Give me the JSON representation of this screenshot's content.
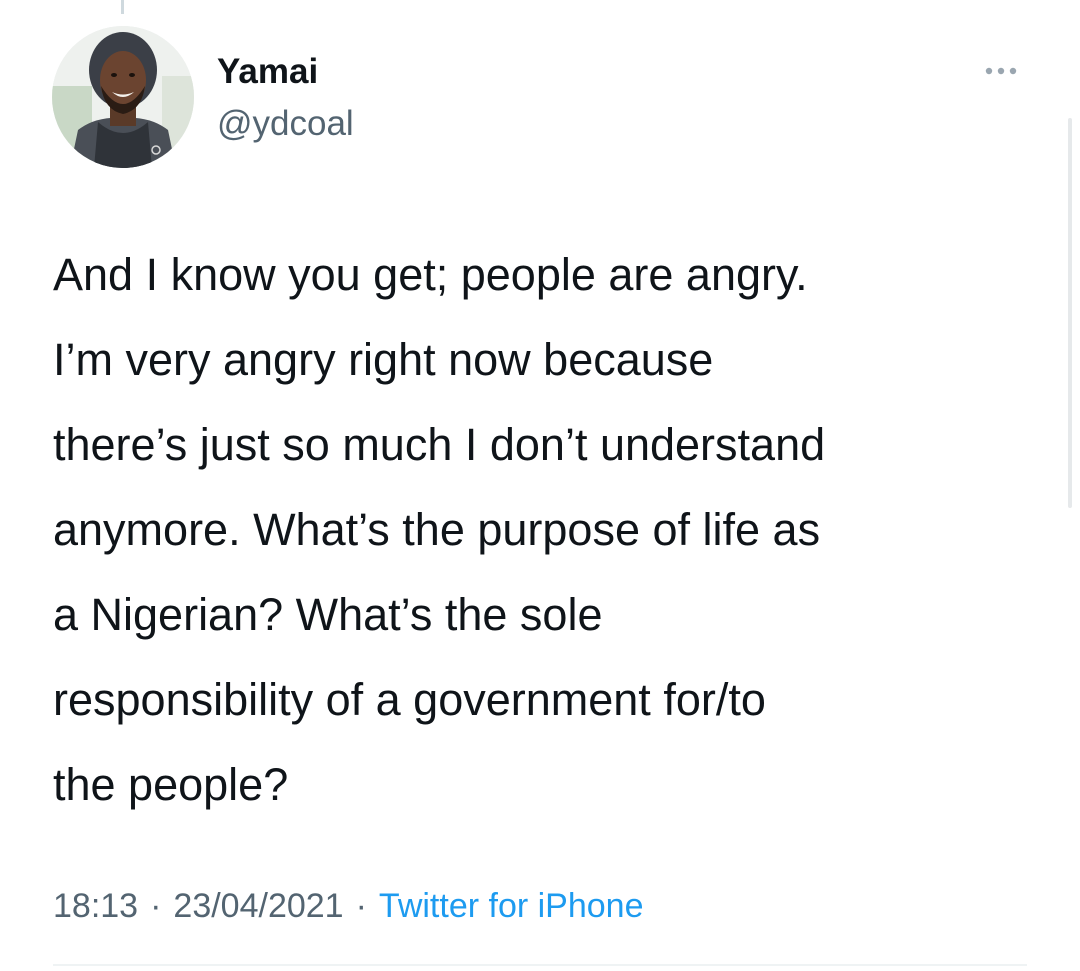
{
  "tweet": {
    "author": {
      "display_name": "Yamai",
      "handle": "@ydcoal",
      "avatar_icon": "user-avatar-photo"
    },
    "more_icon": "more-horizontal-icon",
    "text_lines": [
      "And I know you get; people are angry.",
      "I’m very angry right now because",
      "there’s just so much I don’t understand",
      "anymore. What’s the purpose of life as",
      "a Nigerian? What’s the sole",
      "responsibility of a government for/to",
      "the people?"
    ],
    "time": "18:13",
    "date": "23/04/2021",
    "separator": "·",
    "source": "Twitter for iPhone"
  },
  "colors": {
    "text_primary": "#0f1419",
    "text_secondary": "#536471",
    "accent": "#1d9bf0"
  }
}
